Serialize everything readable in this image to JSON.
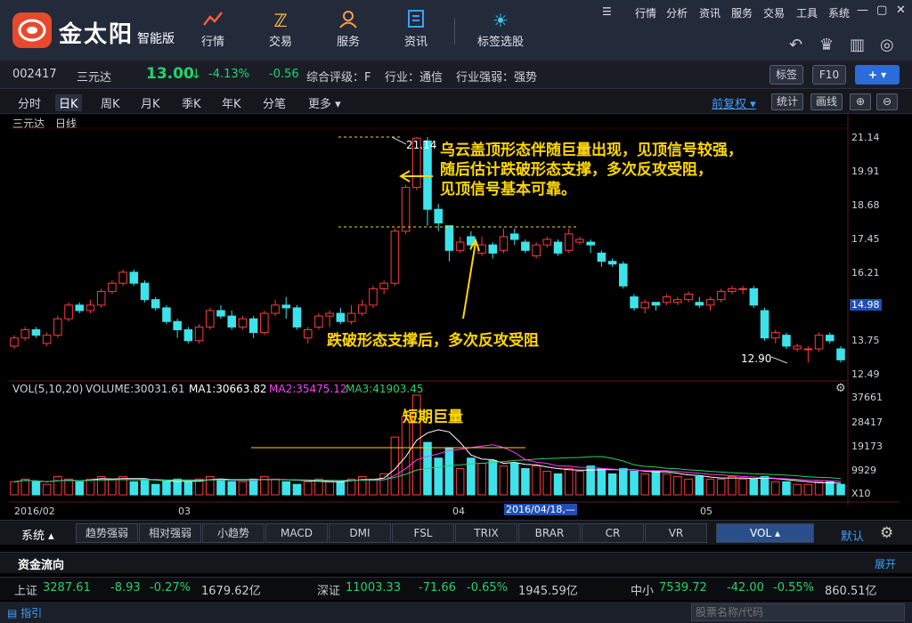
{
  "app": {
    "logo_text": "金太阳",
    "logo_sub": "智能版"
  },
  "nav": [
    {
      "label": "行情",
      "icon": "trend-icon"
    },
    {
      "label": "交易",
      "icon": "trade-icon"
    },
    {
      "label": "服务",
      "icon": "service-icon"
    },
    {
      "label": "资讯",
      "icon": "news-icon"
    },
    {
      "label": "标签选股",
      "icon": "bulb-icon"
    }
  ],
  "menu": [
    "行情",
    "分析",
    "资讯",
    "服务",
    "交易",
    "工具",
    "系统"
  ],
  "quote": {
    "code": "002417",
    "name": "三元达",
    "price": "13.00",
    "arrow": "↓",
    "change_pct": "-4.13%",
    "change": "-0.56",
    "rating": "综合评级：F",
    "industry": "行业：通信",
    "strength": "行业强弱：强势",
    "tag_btn": "标签",
    "f10_btn": "F10",
    "plus_btn": "+"
  },
  "period_tabs": [
    "分时",
    "日K",
    "周K",
    "月K",
    "季K",
    "年K",
    "分笔",
    "更多"
  ],
  "right_btns": {
    "fq": "前复权",
    "stat": "统计",
    "draw": "画线"
  },
  "chart_header": {
    "name": "三元达",
    "period": "日线"
  },
  "price_axis": [
    "21.14",
    "19.91",
    "18.68",
    "17.45",
    "16.21",
    "14.98",
    "13.75",
    "12.49"
  ],
  "high_label": "21.14",
  "low_label": "12.90",
  "annotations": {
    "top": [
      "乌云盖顶形态伴随巨量出现，见顶信号较强，",
      "随后估计跌破形态支撑，多次反攻受阻，",
      "见顶信号基本可靠。"
    ],
    "mid": "跌破形态支撑后，多次反攻受阻",
    "vol": "短期巨量"
  },
  "vol_header": {
    "vol": "VOL(5,10,20)",
    "volume": "VOLUME:30031.61",
    "ma1": "MA1:30663.82",
    "ma2": "MA2:35475.12",
    "ma3": "MA3:41903.45"
  },
  "vol_axis": [
    "37661",
    "28417",
    "19173",
    "9929",
    "X10"
  ],
  "date_axis": {
    "d1": "2016/02",
    "d2": "03",
    "d3": "04",
    "cursor": "2016/04/18,—",
    "d4": "05"
  },
  "indicator_tabs": [
    "趋势强弱",
    "相对强弱",
    "小趋势",
    "MACD",
    "DMI",
    "FSL",
    "TRIX",
    "BRAR",
    "CR",
    "VR",
    "VOL"
  ],
  "system_label": "系统",
  "default_label": "默认",
  "flow": {
    "title": "资金流向",
    "expand": "展开"
  },
  "indices": [
    {
      "name": "上证",
      "value": "3287.61",
      "change": "-8.93",
      "pct": "-0.27%",
      "amount": "1679.62亿"
    },
    {
      "name": "深证",
      "value": "11003.33",
      "change": "-71.66",
      "pct": "-0.65%",
      "amount": "1945.59亿"
    },
    {
      "name": "中小",
      "value": "7539.72",
      "change": "-42.00",
      "pct": "-0.55%",
      "amount": "860.51亿"
    }
  ],
  "status": {
    "left": "指引",
    "search_placeholder": "股票名称/代码"
  },
  "colors": {
    "up": "#ff3b3b",
    "down": "#3de3ea",
    "ma1": "#ffffff",
    "ma2": "#ff3bff",
    "ma3": "#23d36b",
    "annot": "#ffd700"
  },
  "chart_data": {
    "type": "candlestick",
    "x_labels": [
      "2016/02",
      "03",
      "04",
      "05"
    ],
    "ylim": [
      12.49,
      21.14
    ],
    "candles": [
      [
        13.5,
        13.8,
        13.4,
        13.9
      ],
      [
        13.8,
        14.1,
        13.7,
        14.2
      ],
      [
        14.1,
        13.9,
        13.8,
        14.2
      ],
      [
        13.6,
        13.9,
        13.5,
        14.0
      ],
      [
        13.9,
        14.5,
        13.8,
        14.6
      ],
      [
        14.5,
        15.0,
        14.4,
        15.1
      ],
      [
        15.0,
        14.8,
        14.7,
        15.1
      ],
      [
        14.8,
        15.0,
        14.7,
        15.2
      ],
      [
        15.0,
        15.5,
        14.9,
        15.6
      ],
      [
        15.5,
        15.8,
        15.4,
        15.9
      ],
      [
        15.8,
        16.2,
        15.7,
        16.3
      ],
      [
        16.2,
        15.8,
        15.7,
        16.3
      ],
      [
        15.8,
        15.2,
        15.1,
        15.9
      ],
      [
        15.2,
        14.9,
        14.8,
        15.3
      ],
      [
        14.9,
        14.4,
        14.3,
        15.0
      ],
      [
        14.4,
        14.1,
        13.8,
        14.5
      ],
      [
        14.1,
        13.7,
        13.6,
        14.2
      ],
      [
        13.7,
        14.2,
        13.6,
        14.3
      ],
      [
        14.2,
        14.8,
        14.1,
        14.9
      ],
      [
        14.8,
        14.6,
        14.5,
        15.0
      ],
      [
        14.6,
        14.2,
        14.1,
        14.8
      ],
      [
        14.2,
        14.5,
        14.1,
        14.6
      ],
      [
        14.5,
        14.0,
        13.8,
        14.6
      ],
      [
        14.0,
        14.7,
        13.9,
        14.8
      ],
      [
        14.7,
        15.0,
        14.6,
        15.2
      ],
      [
        15.0,
        14.9,
        14.5,
        15.3
      ],
      [
        14.9,
        14.2,
        14.1,
        15.0
      ],
      [
        13.8,
        14.1,
        13.6,
        14.2
      ],
      [
        14.2,
        14.6,
        14.1,
        14.7
      ],
      [
        14.6,
        14.7,
        14.2,
        14.8
      ],
      [
        14.7,
        14.4,
        14.3,
        14.9
      ],
      [
        14.4,
        14.7,
        14.3,
        15.0
      ],
      [
        14.7,
        15.0,
        14.6,
        15.2
      ],
      [
        15.0,
        15.6,
        14.9,
        15.7
      ],
      [
        15.6,
        15.8,
        15.4,
        15.9
      ],
      [
        15.8,
        17.7,
        15.7,
        17.8
      ],
      [
        17.7,
        19.3,
        17.6,
        19.4
      ],
      [
        19.3,
        21.1,
        19.2,
        21.14
      ],
      [
        21.0,
        18.5,
        17.9,
        21.14
      ],
      [
        18.5,
        18.0,
        17.7,
        18.7
      ],
      [
        17.9,
        17.0,
        16.6,
        17.9
      ],
      [
        17.0,
        17.3,
        16.9,
        17.5
      ],
      [
        17.5,
        17.2,
        17.0,
        17.7
      ],
      [
        16.9,
        17.2,
        16.8,
        17.5
      ],
      [
        17.2,
        16.9,
        16.7,
        17.3
      ],
      [
        17.0,
        17.5,
        16.9,
        17.8
      ],
      [
        17.6,
        17.4,
        17.2,
        17.8
      ],
      [
        17.3,
        17.0,
        16.9,
        17.4
      ],
      [
        16.8,
        17.2,
        16.7,
        17.3
      ],
      [
        17.2,
        17.4,
        17.1,
        17.5
      ],
      [
        17.3,
        16.9,
        16.8,
        17.4
      ],
      [
        17.0,
        17.6,
        16.9,
        17.8
      ],
      [
        17.3,
        17.4,
        17.2,
        17.5
      ],
      [
        17.3,
        17.2,
        16.9,
        17.4
      ],
      [
        16.9,
        16.6,
        16.4,
        17.0
      ],
      [
        16.6,
        16.5,
        16.4,
        16.7
      ],
      [
        16.5,
        15.7,
        15.6,
        16.6
      ],
      [
        15.3,
        14.9,
        14.8,
        15.4
      ],
      [
        14.9,
        15.1,
        14.7,
        15.2
      ],
      [
        15.1,
        15.0,
        14.8,
        15.1
      ],
      [
        15.1,
        15.3,
        15.0,
        15.4
      ],
      [
        15.1,
        15.2,
        15.0,
        15.3
      ],
      [
        15.2,
        15.4,
        15.1,
        15.5
      ],
      [
        15.1,
        15.0,
        14.9,
        15.3
      ],
      [
        15.0,
        15.2,
        14.8,
        15.3
      ],
      [
        15.2,
        15.5,
        15.1,
        15.6
      ],
      [
        15.5,
        15.6,
        15.4,
        15.7
      ],
      [
        15.6,
        15.6,
        15.4,
        15.7
      ],
      [
        15.6,
        15.0,
        14.9,
        15.7
      ],
      [
        14.8,
        13.8,
        13.7,
        14.9
      ],
      [
        13.8,
        14.0,
        13.6,
        14.1
      ],
      [
        13.9,
        13.5,
        13.4,
        14.0
      ],
      [
        13.4,
        13.5,
        13.3,
        13.6
      ],
      [
        13.4,
        13.4,
        12.9,
        13.5
      ],
      [
        13.4,
        13.9,
        13.3,
        14.0
      ],
      [
        13.9,
        13.7,
        13.6,
        14.0
      ],
      [
        13.4,
        13.0,
        12.9,
        13.5
      ]
    ],
    "volume": [
      5,
      6,
      5,
      4,
      7,
      6,
      5,
      6,
      7,
      6,
      7,
      5,
      6,
      4,
      5,
      6,
      5,
      6,
      7,
      6,
      5,
      5,
      6,
      7,
      6,
      5,
      4,
      5,
      6,
      5,
      5,
      6,
      7,
      6,
      8,
      22,
      30,
      38,
      20,
      14,
      18,
      10,
      14,
      12,
      13,
      11,
      12,
      10,
      11,
      9,
      8,
      10,
      9,
      11,
      10,
      8,
      10,
      9,
      8,
      9,
      8,
      7,
      6,
      7,
      6,
      6,
      7,
      6,
      6,
      7,
      5,
      5,
      4,
      4,
      5,
      5,
      4
    ]
  }
}
